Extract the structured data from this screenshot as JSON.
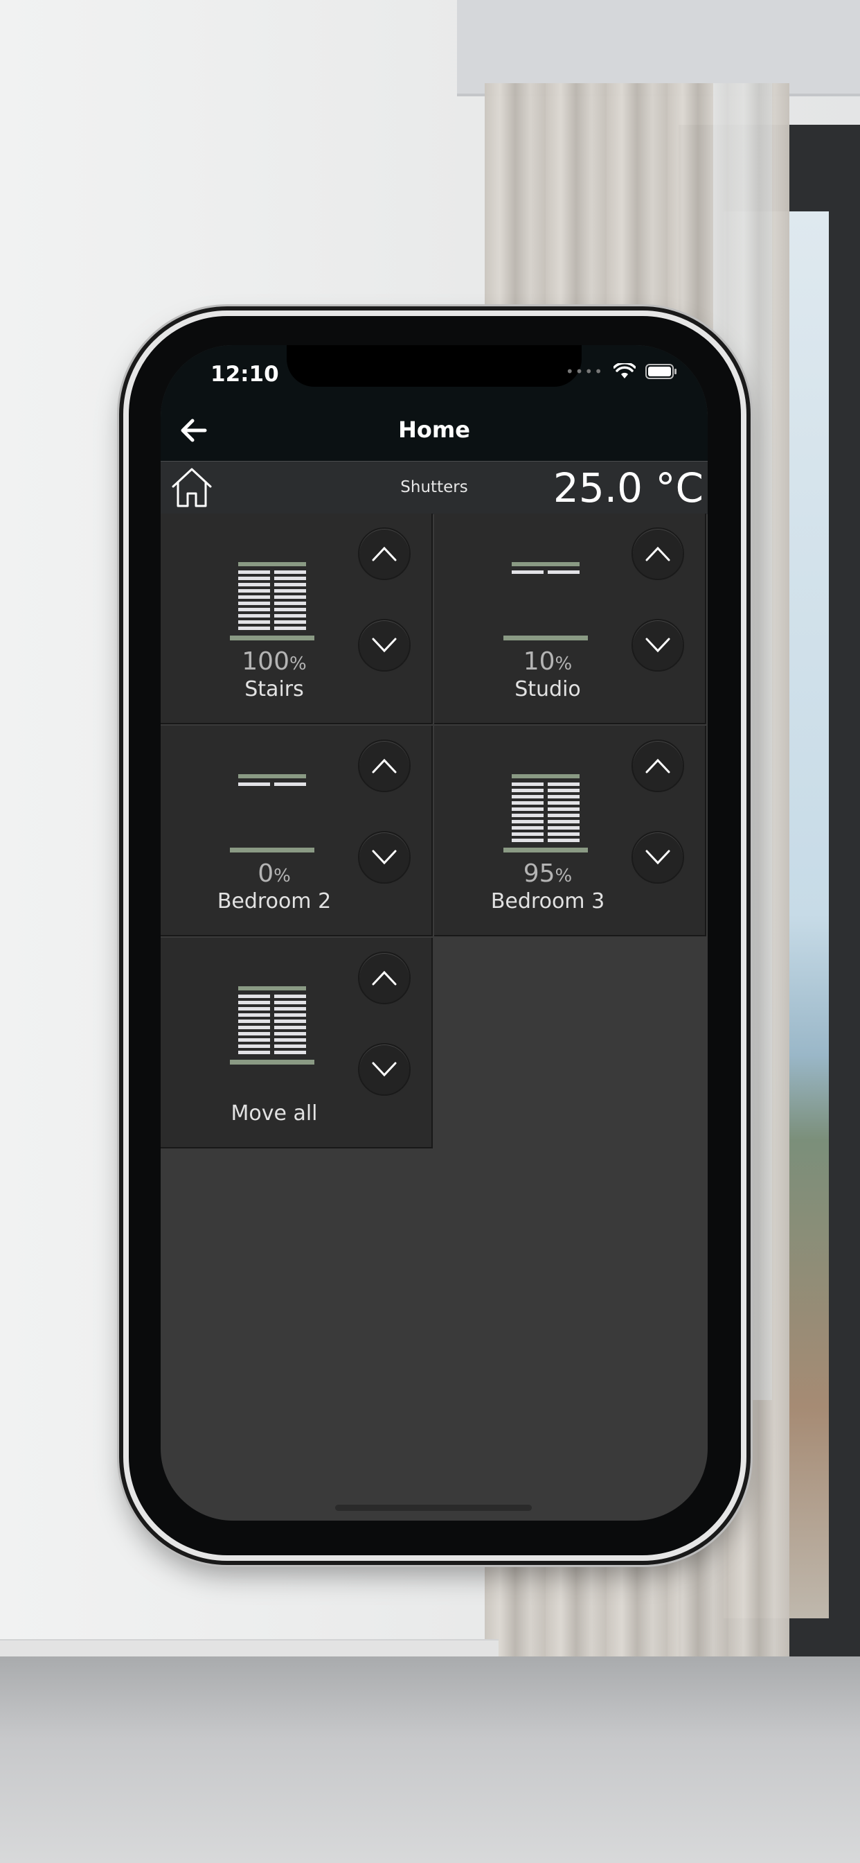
{
  "status_bar": {
    "time": "12:10",
    "wifi_icon": "wifi-icon",
    "battery_icon": "battery-icon"
  },
  "header": {
    "title": "Home",
    "back_icon": "arrow-left-icon"
  },
  "subbar": {
    "home_icon": "house-icon",
    "section": "Shutters",
    "temperature": "25.0 °C"
  },
  "colors": {
    "bar_green": "#8a9a84",
    "slat": "#e2e2e6",
    "tile_bg": "#2b2b2b",
    "screen_bg": "#3a3a3a"
  },
  "shutters": [
    {
      "name": "Stairs",
      "percent": "100",
      "unit": "%",
      "level": 1.0
    },
    {
      "name": "Studio",
      "percent": "10",
      "unit": "%",
      "level": 0.1
    },
    {
      "name": "Bedroom 2",
      "percent": "0",
      "unit": "%",
      "level": 0.0
    },
    {
      "name": "Bedroom 3",
      "percent": "95",
      "unit": "%",
      "level": 0.95
    },
    {
      "name": "Move all",
      "percent": "",
      "unit": "",
      "level": 1.0
    }
  ]
}
